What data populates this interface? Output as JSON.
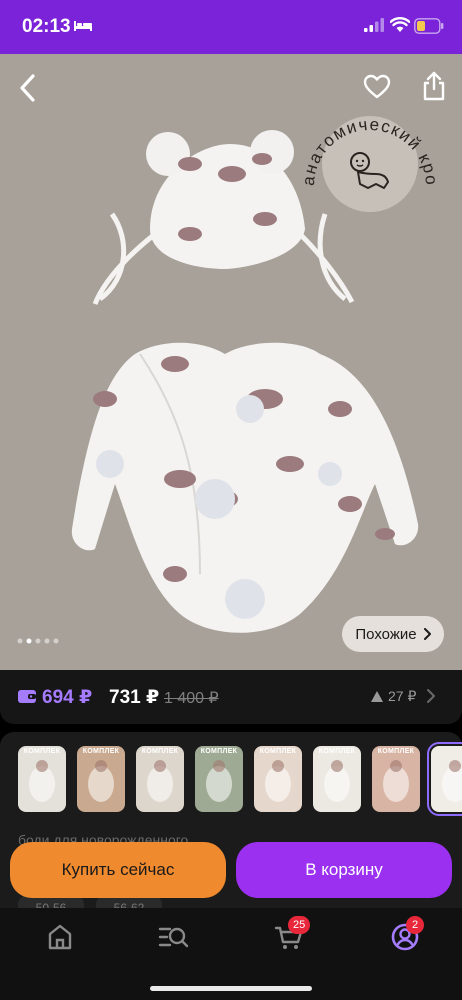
{
  "status_bar": {
    "time": "02:13",
    "icons": [
      "bed-icon",
      "signal-icon",
      "wifi-icon",
      "battery-icon"
    ],
    "background_color": "#7a23d9"
  },
  "hero": {
    "badge_text": "анатомический крой",
    "similar_label": "Похожие",
    "image_count": 5,
    "active_image": 2,
    "icons": [
      "back-icon",
      "heart-icon",
      "share-icon",
      "baby-icon"
    ]
  },
  "price": {
    "wallet_price": "694 ₽",
    "price": "731 ₽",
    "old_price": "1 400 ₽",
    "reviews_count": "27 ₽",
    "accent_color": "#a67cff"
  },
  "variants": {
    "thumbs": [
      {
        "label": "КОМПЛЕК"
      },
      {
        "label": "КОМПЛЕК"
      },
      {
        "label": "КОМПЛЕК"
      },
      {
        "label": "КОМПЛЕК"
      },
      {
        "label": "КОМПЛЕК"
      },
      {
        "label": "КОМПЛЕК"
      },
      {
        "label": "КОМПЛЕК"
      },
      {
        "label": ""
      }
    ],
    "description_peek": "боди для новорожденного",
    "sizes": [
      "50-56",
      "56-62"
    ]
  },
  "actions": {
    "buy_now": "Купить сейчас",
    "add_to_cart": "В корзину",
    "buy_color": "#f08a2e",
    "cart_color": "#9b30f0"
  },
  "bottom_nav": {
    "items": [
      "home-icon",
      "catalog-icon",
      "cart-icon",
      "profile-icon"
    ],
    "cart_badge": "25",
    "profile_badge": "2"
  }
}
